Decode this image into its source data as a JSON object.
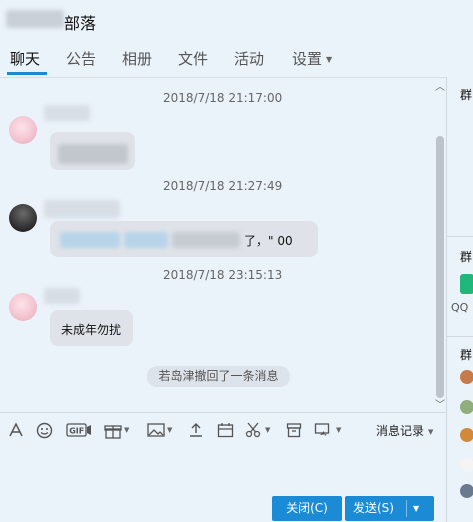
{
  "window": {
    "title_suffix": "部落"
  },
  "tabs": [
    {
      "label": "聊天"
    },
    {
      "label": "公告"
    },
    {
      "label": "相册"
    },
    {
      "label": "文件"
    },
    {
      "label": "活动"
    },
    {
      "label": "设置"
    }
  ],
  "messages": [
    {
      "timestamp": "2018/7/18 21:17:00",
      "text": ""
    },
    {
      "timestamp": "2018/7/18 21:27:49",
      "text": "了，\" 00"
    },
    {
      "timestamp": "2018/7/18 23:15:13",
      "text": "未成年勿扰"
    }
  ],
  "system_note": "若岛津撤回了一条消息",
  "toolbar": {
    "history_label": "消息记录"
  },
  "right_panel": {
    "section_label_1": "群",
    "section_label_2": "群",
    "section_label_3": "群",
    "qq_label": "QQ"
  },
  "buttons": {
    "close_label": "关闭(C)",
    "send_label": "发送(S)"
  },
  "colors": {
    "accent": "#1b8bd5",
    "background": "#eaf2fa",
    "bubble": "#dfe3e9"
  }
}
